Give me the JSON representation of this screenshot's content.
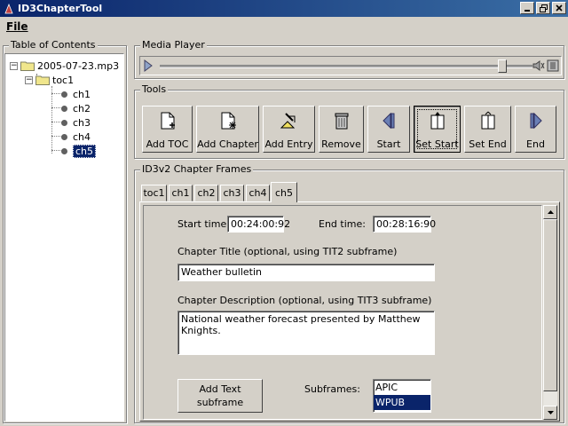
{
  "window": {
    "title": "ID3ChapterTool"
  },
  "menu": {
    "file_label": "File"
  },
  "toc": {
    "group_label": "Table of Contents",
    "root": "2005-07-23.mp3",
    "toc_node": "toc1",
    "chapters": [
      "ch1",
      "ch2",
      "ch3",
      "ch4",
      "ch5"
    ],
    "selected_chapter": "ch5"
  },
  "media_player": {
    "group_label": "Media Player",
    "position_percent": 92
  },
  "tools": {
    "group_label": "Tools",
    "buttons": [
      "Add TOC",
      "Add Chapter",
      "Add Entry",
      "Remove",
      "Start",
      "Set Start",
      "Set End",
      "End"
    ],
    "active_button": "Set Start"
  },
  "frames": {
    "group_label": "ID3v2 Chapter Frames",
    "tabs": [
      "toc1",
      "ch1",
      "ch2",
      "ch3",
      "ch4",
      "ch5"
    ],
    "active_tab": "ch5"
  },
  "chapter_form": {
    "start_time_label": "Start time:",
    "start_time_value": "00:24:00:92",
    "end_time_label": "End time:",
    "end_time_value": "00:28:16:90",
    "title_label": "Chapter Title (optional, using TIT2 subframe)",
    "title_value": "Weather bulletin",
    "description_label": "Chapter Description (optional, using TIT3 subframe)",
    "description_value": "National weather forecast presented by Matthew Knights.",
    "add_text_label_line1": "Add Text",
    "add_text_label_line2": "subframe",
    "subframes_label": "Subframes:",
    "subframes": [
      "APIC",
      "WPUB"
    ],
    "selected_subframe": "WPUB"
  },
  "colors": {
    "title_bar": "#0a246a",
    "selection": "#0a246a",
    "face": "#d4d0c8"
  }
}
